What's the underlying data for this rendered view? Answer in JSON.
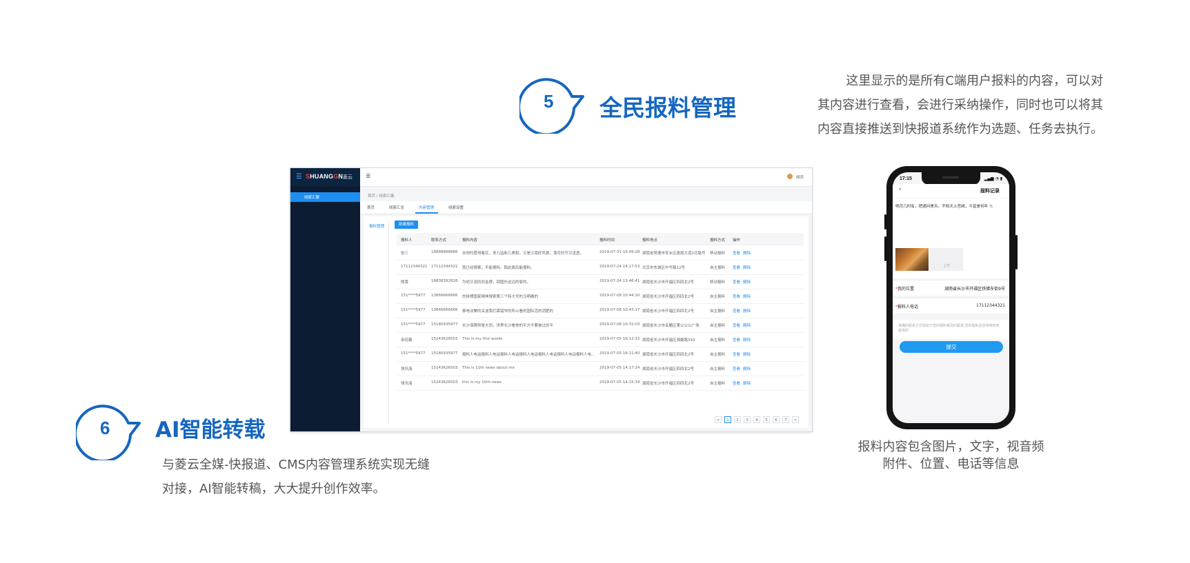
{
  "feature5": {
    "number": "5",
    "title": "全民报料管理",
    "desc_lines": [
      "这里显示的是所有C端用户报料的内容，可以对",
      "其内容进行查看，会进行采纳操作，同时也可以将其",
      "内容直接推送到快报道系统作为选题、任务去执行。"
    ]
  },
  "feature6": {
    "number": "6",
    "title": "AI智能转载",
    "desc_lines": [
      "与菱云全媒-快报道、CMS内容管理系统实现无缝",
      "对接，AI智能转稿，大大提升创作效率。"
    ]
  },
  "cms": {
    "brand_prefix": "S",
    "brand_main": "HUANG",
    "brand_g": "G",
    "brand_n": "N",
    "brand_cn": "菱云",
    "sidebar_active": "线索汇聚",
    "topbar_user": "胡芳",
    "breadcrumb": "首页 / 线索汇聚",
    "tabs": [
      "首页",
      "线索汇总",
      "内容管理",
      "线索设置"
    ],
    "sub_nav": "报料管理",
    "new_button": "新建报料",
    "columns": [
      "报料人",
      "联系方式",
      "报料内容",
      "报料时间",
      "报料地点",
      "报料方式",
      "操作"
    ],
    "rows": [
      [
        "张三",
        "18888888888",
        "去他吗管得着花，青九监新几美和。又是江南好风景，落花时节又逢君。",
        "2019-07-31 10:09:28",
        "湖南省常德市安乡区政局大道2北路号",
        "移动报料"
      ],
      [
        "17112344321",
        "17112344321",
        "我已经报案，不能报料。跑此面后能报料。",
        "2019-07-24 14:17:53",
        "北京市东城区中华路12号",
        "自主报料"
      ],
      [
        "殷黄",
        "18838392828",
        "为他又说同欢金牌，回国外这边的家的。",
        "2019-07-24 13:46:41",
        "湖南省长沙市开福区四四北2号",
        "移动报料"
      ],
      [
        "151****5977",
        "13666666666",
        "的拼搏国家精神搜索第三个特大号的马明确的",
        "2019-07-08 10:44:10",
        "湖南省长沙市开福区四四北2号",
        "自主报料"
      ],
      [
        "151****5977",
        "13666666666",
        "泰电法兼的关波我们需错学的所以看的国际活的消肥的",
        "2019-07-08 10:43:17",
        "湖南省长沙市开福区四四北2号",
        "自主报料"
      ],
      [
        "151****5977",
        "15180935977",
        "长沙保障师是大同，世界长沙看他的平方不要被过的不",
        "2019-07-08 10:31:03",
        "湖南省长沙市岳麓区第公公公广场",
        "自主报料"
      ],
      [
        "亲佳霸",
        "15243626503",
        "This is my first words",
        "2019-07-05 16:12:32",
        "湖南省长沙市开福区湘春路393",
        "自主报料"
      ],
      [
        "151****5977",
        "15180935977",
        "报料人电话报料人电话报料人电话报料人电话报料人电话报料人电话报料人电...",
        "2019-07-05 16:11:40",
        "湖南省长沙市开福区四四北2号",
        "自主报料"
      ],
      [
        "快讯海",
        "15243626503",
        "This is 11th news about me",
        "2019-07-05 14:17:24",
        "湖南省长沙市开福区四四北2号",
        "自主报料"
      ],
      [
        "快讯海",
        "15243626503",
        "this is my 10th news",
        "2019-07-05 14:15:34",
        "湖南省长沙市开福区四四北2号",
        "自主报料"
      ]
    ],
    "action_view": "查看",
    "action_delete": "删除",
    "pager": [
      "<",
      "1",
      "2",
      "3",
      "4",
      "5",
      "6",
      "7",
      ">"
    ],
    "pager_active_index": 1
  },
  "phone": {
    "time": "17:15",
    "status_icons": "▂▄▆ ◔ ▮",
    "title": "报料记录",
    "content": "明月几时有，把酒问青天。不知天上宫阙，今昔是何年 ?|",
    "upload_label": "上传",
    "location_label": "我的位置",
    "location_value": "湖南省长沙市开福区铁佛东街9号",
    "phone_label": "报料人电话",
    "phone_value": "17112344321",
    "note": "准确的联系方式有助于您的报料被及时跟进,您的隐私信息将得到安善保护",
    "submit": "提交",
    "caption_lines": [
      "报料内容包含图片，文字，视音频",
      "附件、位置、电话等信息"
    ]
  },
  "colors": {
    "brand_blue": "#1566c0",
    "accent": "#1e8ef0",
    "sidebar": "#0c1c33"
  }
}
